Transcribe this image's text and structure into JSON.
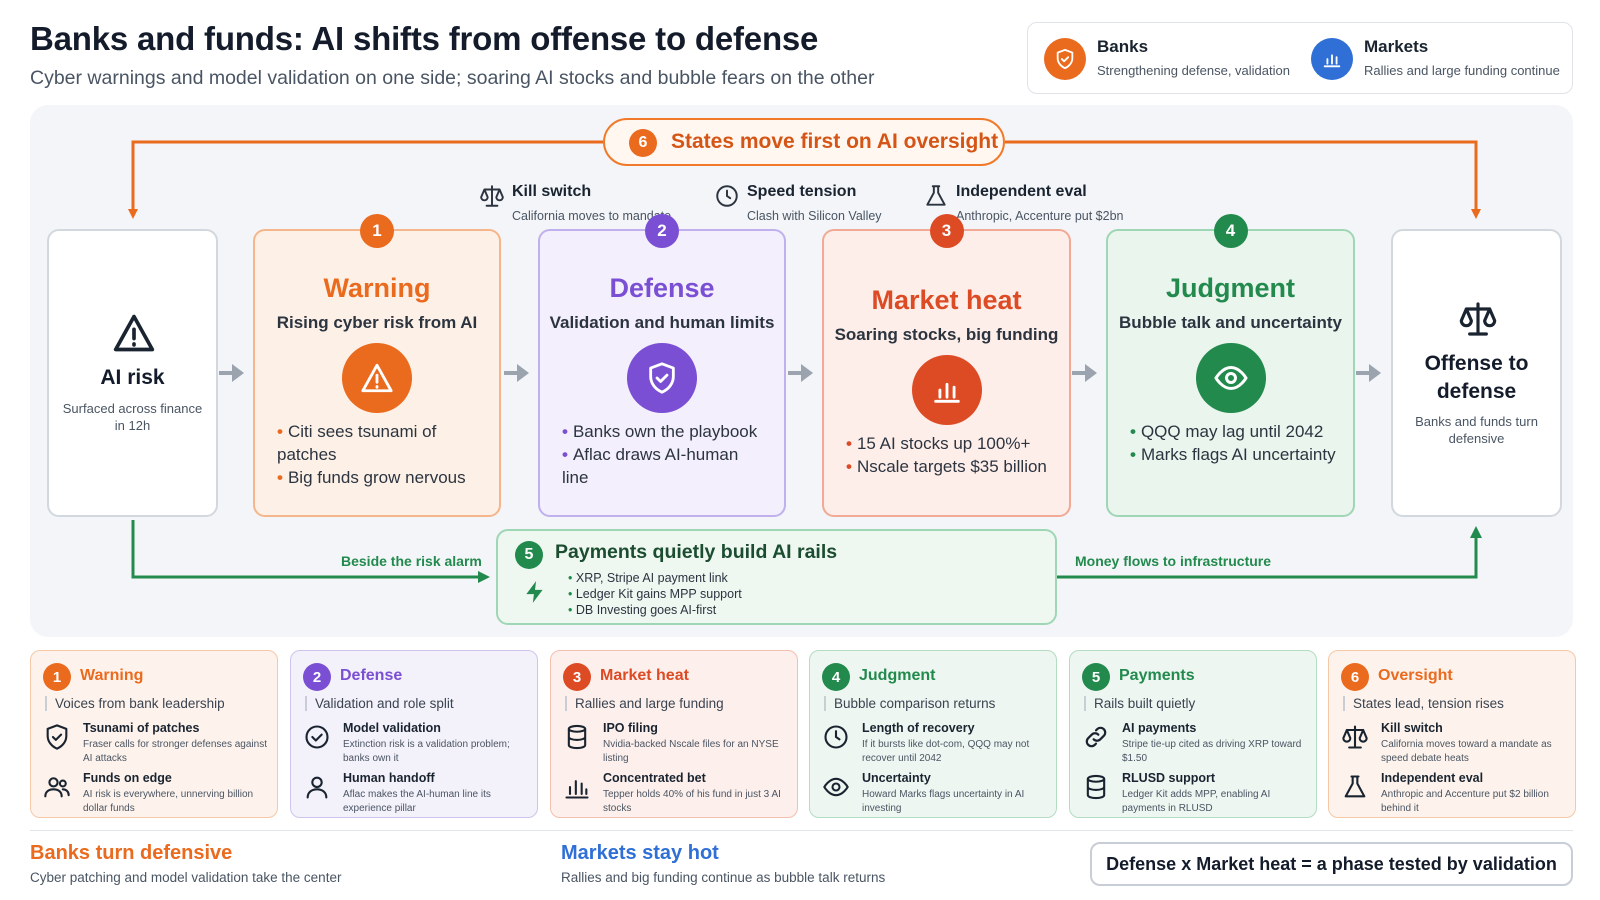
{
  "header": {
    "title": "Banks and funds: AI shifts from offense to defense",
    "subtitle": "Cyber warnings and model validation on one side; soaring AI stocks and bubble fears on the other"
  },
  "legend": [
    {
      "title": "Banks",
      "desc": "Strengthening defense, validation",
      "icon": "shield-icon",
      "color": "#ea6a1e"
    },
    {
      "title": "Markets",
      "desc": "Rallies and large funding continue",
      "icon": "bar-chart-icon",
      "color": "#2f6fd6"
    }
  ],
  "oversight": {
    "number": "6",
    "label": "States move first on AI oversight"
  },
  "features": [
    {
      "title": "Kill switch",
      "desc": "California moves to mandate",
      "icon": "scales-icon"
    },
    {
      "title": "Speed tension",
      "desc": "Clash with Silicon Valley",
      "icon": "clock-icon"
    },
    {
      "title": "Independent eval",
      "desc": "Anthropic, Accenture put $2bn",
      "icon": "flask-icon"
    }
  ],
  "start_box": {
    "title": "AI risk",
    "desc": "Surfaced across finance in 12h",
    "icon": "warning-icon"
  },
  "end_box": {
    "title_line1": "Offense to",
    "title_line2": "defense",
    "desc": "Banks and funds turn defensive",
    "icon": "scales-icon"
  },
  "stages": [
    {
      "number": "1",
      "title": "Warning",
      "subtitle": "Rising cyber risk from AI",
      "icon": "warning-icon",
      "color": "#ea6a1e",
      "bullets": [
        "Citi sees tsunami of patches",
        "Big funds grow nervous"
      ]
    },
    {
      "number": "2",
      "title": "Defense",
      "subtitle": "Validation and human limits",
      "icon": "shield-check-icon",
      "color": "#7a4fd4",
      "bullets": [
        "Banks own the playbook",
        "Aflac draws AI-human line"
      ]
    },
    {
      "number": "3",
      "title": "Market heat",
      "subtitle": "Soaring stocks, big funding",
      "icon": "bar-chart-icon",
      "color": "#dd4b25",
      "bullets": [
        "15 AI stocks up 100%+",
        "Nscale targets $35 billion"
      ]
    },
    {
      "number": "4",
      "title": "Judgment",
      "subtitle": "Bubble talk and uncertainty",
      "icon": "eye-icon",
      "color": "#238a4e",
      "bullets": [
        "QQQ may lag until 2042",
        "Marks flags AI uncertainty"
      ]
    }
  ],
  "payments": {
    "number": "5",
    "title": "Payments quietly build AI rails",
    "bullets": [
      "XRP, Stripe AI payment link",
      "Ledger Kit gains MPP support",
      "DB Investing goes AI-first"
    ],
    "left_label": "Beside the risk alarm",
    "right_label": "Money flows to infrastructure"
  },
  "cards": [
    {
      "number": "1",
      "title": "Warning",
      "sub": "Voices from bank leadership",
      "color": "#ea6a1e",
      "items": [
        {
          "title": "Tsunami of patches",
          "desc": "Fraser calls for stronger defenses against AI attacks",
          "icon": "shield-icon"
        },
        {
          "title": "Funds on edge",
          "desc": "AI risk is everywhere, unnerving billion dollar funds",
          "icon": "users-icon"
        }
      ]
    },
    {
      "number": "2",
      "title": "Defense",
      "sub": "Validation and role split",
      "color": "#7a4fd4",
      "items": [
        {
          "title": "Model validation",
          "desc": "Extinction risk is a validation problem; banks own it",
          "icon": "check-circle-icon"
        },
        {
          "title": "Human handoff",
          "desc": "Aflac makes the AI-human line its experience pillar",
          "icon": "user-icon"
        }
      ]
    },
    {
      "number": "3",
      "title": "Market heat",
      "sub": "Rallies and large funding",
      "color": "#dd4b25",
      "items": [
        {
          "title": "IPO filing",
          "desc": "Nvidia-backed Nscale files for an NYSE listing",
          "icon": "database-icon"
        },
        {
          "title": "Concentrated bet",
          "desc": "Tepper holds 40% of his fund in just 3 AI stocks",
          "icon": "bar-chart-icon"
        }
      ]
    },
    {
      "number": "4",
      "title": "Judgment",
      "sub": "Bubble comparison returns",
      "color": "#238a4e",
      "items": [
        {
          "title": "Length of recovery",
          "desc": "If it bursts like dot-com, QQQ may not recover until 2042",
          "icon": "clock-icon"
        },
        {
          "title": "Uncertainty",
          "desc": "Howard Marks flags uncertainty in AI investing",
          "icon": "eye-icon"
        }
      ]
    },
    {
      "number": "5",
      "title": "Payments",
      "sub": "Rails built quietly",
      "color": "#238a4e",
      "items": [
        {
          "title": "AI payments",
          "desc": "Stripe tie-up cited as driving XRP toward $1.50",
          "icon": "link-icon"
        },
        {
          "title": "RLUSD support",
          "desc": "Ledger Kit adds MPP, enabling AI payments in RLUSD",
          "icon": "database-icon"
        }
      ]
    },
    {
      "number": "6",
      "title": "Oversight",
      "sub": "States lead, tension rises",
      "color": "#ea6a1e",
      "items": [
        {
          "title": "Kill switch",
          "desc": "California moves toward a mandate as speed debate heats",
          "icon": "scales-icon"
        },
        {
          "title": "Independent eval",
          "desc": "Anthropic and Accenture put $2 billion behind it",
          "icon": "flask-icon"
        }
      ]
    }
  ],
  "footer": {
    "left_title": "Banks turn defensive",
    "left_desc": "Cyber patching and model validation take the center",
    "mid_title": "Markets stay hot",
    "mid_desc": "Rallies and big funding continue as bubble talk returns",
    "equation": "Defense x Market heat = a phase tested by validation"
  }
}
